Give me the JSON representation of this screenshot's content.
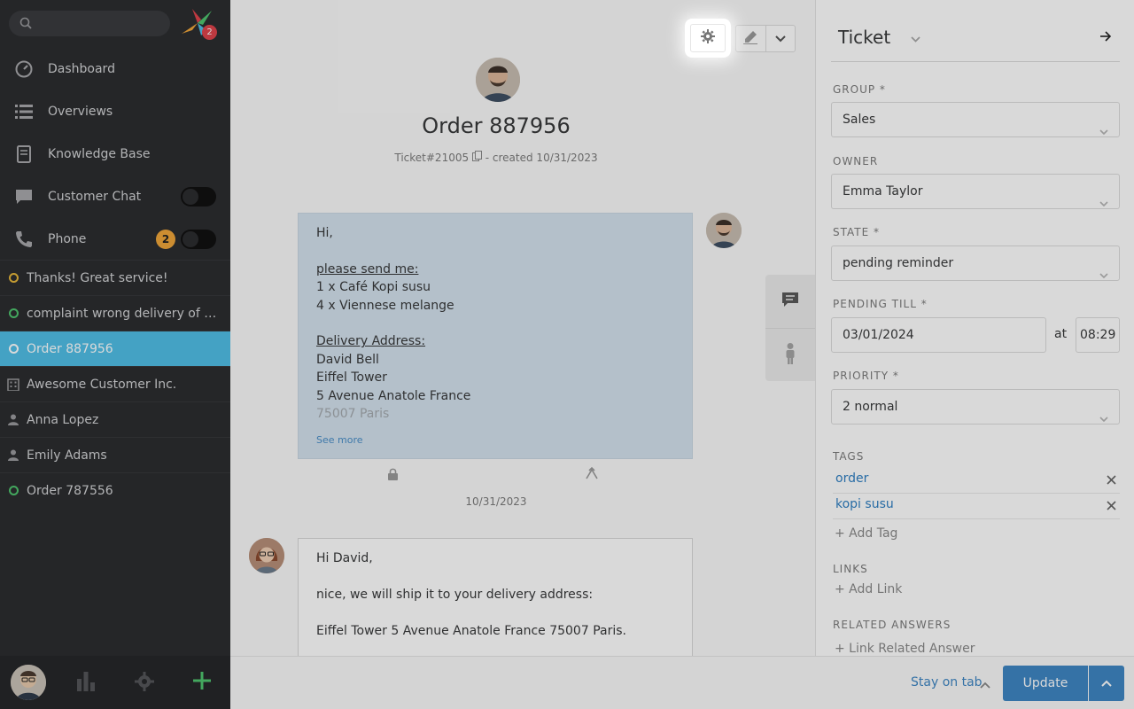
{
  "sidebar": {
    "search": {
      "placeholder": ""
    },
    "logo_badge": "2",
    "nav": [
      {
        "label": "Dashboard",
        "icon": "dashboard-icon"
      },
      {
        "label": "Overviews",
        "icon": "overviews-icon"
      },
      {
        "label": "Knowledge Base",
        "icon": "knowledge-base-icon"
      },
      {
        "label": "Customer Chat",
        "icon": "chat-icon",
        "toggle": false
      },
      {
        "label": "Phone",
        "icon": "phone-icon",
        "badge": "2",
        "toggle": false
      }
    ],
    "tabs": [
      {
        "label": "Thanks! Great service!",
        "icon": "ring-yellow"
      },
      {
        "label": "complaint wrong delivery of order",
        "icon": "ring-green"
      },
      {
        "label": "Order 887956",
        "icon": "ring-white",
        "active": true
      },
      {
        "label": "Awesome Customer Inc.",
        "icon": "organization-icon"
      },
      {
        "label": "Anna Lopez",
        "icon": "person-icon"
      },
      {
        "label": "Emily Adams",
        "icon": "person-icon"
      },
      {
        "label": "Order 787556",
        "icon": "ring-green"
      }
    ]
  },
  "ticket": {
    "title": "Order 887956",
    "number": "Ticket#21005",
    "created": " - created 10/31/2023",
    "articles": [
      {
        "lines": [
          "Hi,",
          "",
          "please send me:",
          "1 x Café Kopi susu",
          "4 x Viennese melange",
          "",
          "Delivery Address:",
          "David Bell",
          "Eiffel Tower",
          "5 Avenue Anatole France",
          "75007 Paris"
        ],
        "see_more": "See more",
        "date": "10/31/2023"
      },
      {
        "lines": [
          "Hi David,",
          "",
          "nice, we will ship it to your delivery address:",
          "",
          "Eiffel Tower 5 Avenue Anatole France 75007 Paris."
        ]
      }
    ]
  },
  "rsidebar": {
    "title": "Ticket",
    "group": {
      "label": "GROUP *",
      "value": "Sales"
    },
    "owner": {
      "label": "OWNER",
      "value": "Emma Taylor"
    },
    "state": {
      "label": "STATE *",
      "value": "pending reminder"
    },
    "pending": {
      "label": "PENDING TILL *",
      "date": "03/01/2024",
      "at": "at",
      "time": "08:29"
    },
    "priority": {
      "label": "PRIORITY *",
      "value": "2 normal"
    },
    "tags": {
      "label": "TAGS",
      "items": [
        "order",
        "kopi susu"
      ],
      "add": "+ Add Tag"
    },
    "links": {
      "label": "LINKS",
      "add": "+ Add Link"
    },
    "related": {
      "label": "RELATED ANSWERS",
      "add": "+ Link Related Answer"
    }
  },
  "bottom": {
    "stay_on_tab": "Stay on tab",
    "update": "Update"
  },
  "colors": {
    "sidebar_bg": "#2c2d30",
    "active_tab": "#50bfe7",
    "primary": "#3f86c4",
    "customer_article_bg": "#d4e2ee",
    "badge": "#f0a63a"
  }
}
